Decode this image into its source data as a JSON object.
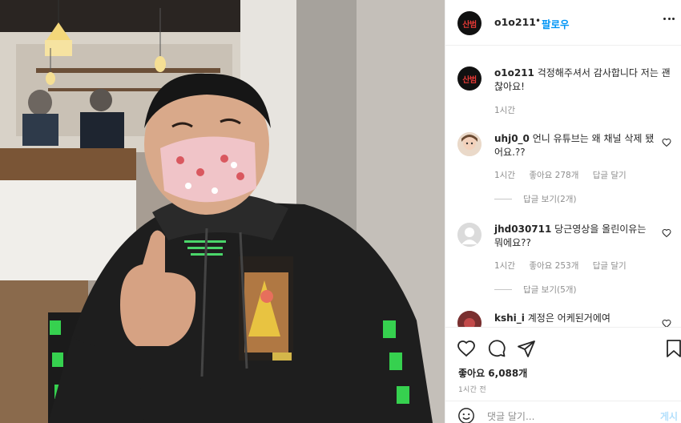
{
  "post": {
    "username": "o1o211",
    "separator": "•",
    "follow_label": "팔로우",
    "avatar_text": "산범"
  },
  "caption": {
    "username": "o1o211",
    "text": "걱정해주셔서 감사합니다 저는 괜찮아요!",
    "time": "1시간"
  },
  "comments": [
    {
      "username": "uhj0_0",
      "text": "언니 유튜브는 왜 채널 삭제 됐어요.??",
      "time": "1시간",
      "likes": "좋아요 278개",
      "reply_label": "답글 달기",
      "view_replies": "답글 보기(2개)"
    },
    {
      "username": "jhd030711",
      "text": "당근영상을 올린이유는 뭐에요??",
      "time": "1시간",
      "likes": "좋아요 253개",
      "reply_label": "답글 달기",
      "view_replies": "답글 보기(5개)"
    },
    {
      "username": "kshi_i",
      "text": "계정은 어케된거에여"
    }
  ],
  "footer": {
    "likes": "좋아요 6,088개",
    "time": "1시간 전",
    "add_comment_placeholder": "댓글 달기...",
    "post_label": "게시"
  },
  "icons": {
    "like": "heart-icon",
    "comment": "comment-icon",
    "share": "share-icon",
    "save": "bookmark-icon",
    "more": "more-options-icon",
    "emoji": "emoji-icon"
  },
  "colors": {
    "link_blue": "#0095f6",
    "brand_red": "#e53935",
    "muted_gray": "#8e8e8e"
  }
}
